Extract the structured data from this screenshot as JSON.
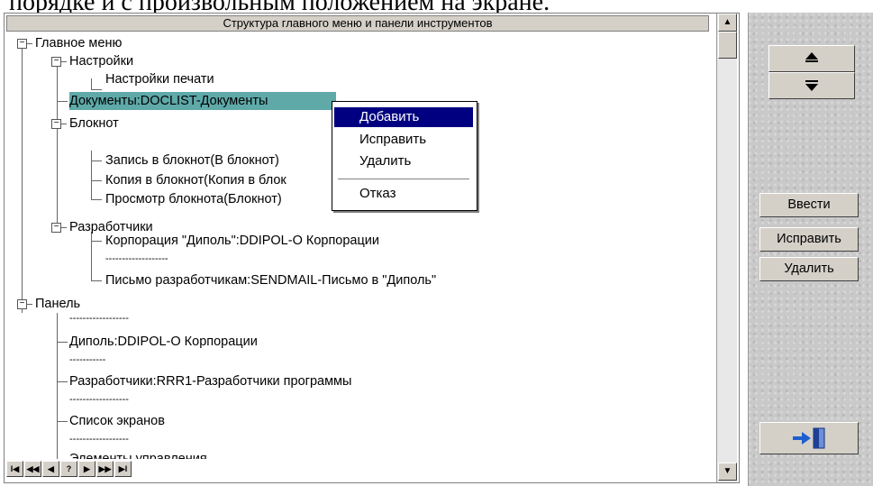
{
  "document": {
    "caption_fragment": "порядке и с произвольным положением на экране."
  },
  "window": {
    "header": "Структура главного меню и панели инструментов"
  },
  "tree": {
    "items": [
      {
        "label": "Главное меню"
      },
      {
        "label": "Настройки"
      },
      {
        "label": "Настройки печати"
      },
      {
        "label": "Документы:DOCLIST-Документы"
      },
      {
        "label": "Блокнот"
      },
      {
        "label": "Запись в блокнот(В блокнот)"
      },
      {
        "label": "Копия в блокнот(Копия в блок"
      },
      {
        "label": "Просмотр блокнота(Блокнот)"
      },
      {
        "label": "Разработчики"
      },
      {
        "label": "Корпорация \"Диполь\":DDIPOL-О Корпорации"
      },
      {
        "label": "-------------------"
      },
      {
        "label": "Письмо разработчикам:SENDMAIL-Письмо в \"Диполь\""
      },
      {
        "label": "Панель"
      },
      {
        "label": "------------------"
      },
      {
        "label": "Диполь:DDIPOL-О Корпорации"
      },
      {
        "label": "-----------"
      },
      {
        "label": "Разработчики:RRR1-Разработчики программы"
      },
      {
        "label": "------------------"
      },
      {
        "label": "Список экранов"
      },
      {
        "label": "------------------"
      },
      {
        "label": "Элементы управления"
      }
    ]
  },
  "context_menu": {
    "items": [
      {
        "label": "Добавить"
      },
      {
        "label": "Исправить"
      },
      {
        "label": "Удалить"
      },
      {
        "label": "Отказ"
      }
    ]
  },
  "navigator": {
    "buttons": [
      "I◀",
      "◀◀",
      "◀",
      "?",
      "▶",
      "▶▶",
      "▶I"
    ]
  },
  "side_panel": {
    "enter_label": "Ввести",
    "edit_label": "Исправить",
    "delete_label": "Удалить"
  },
  "colors": {
    "selection": "#5fa9a9",
    "menu_highlight": "#000080",
    "panel": "#c9c9c9"
  }
}
